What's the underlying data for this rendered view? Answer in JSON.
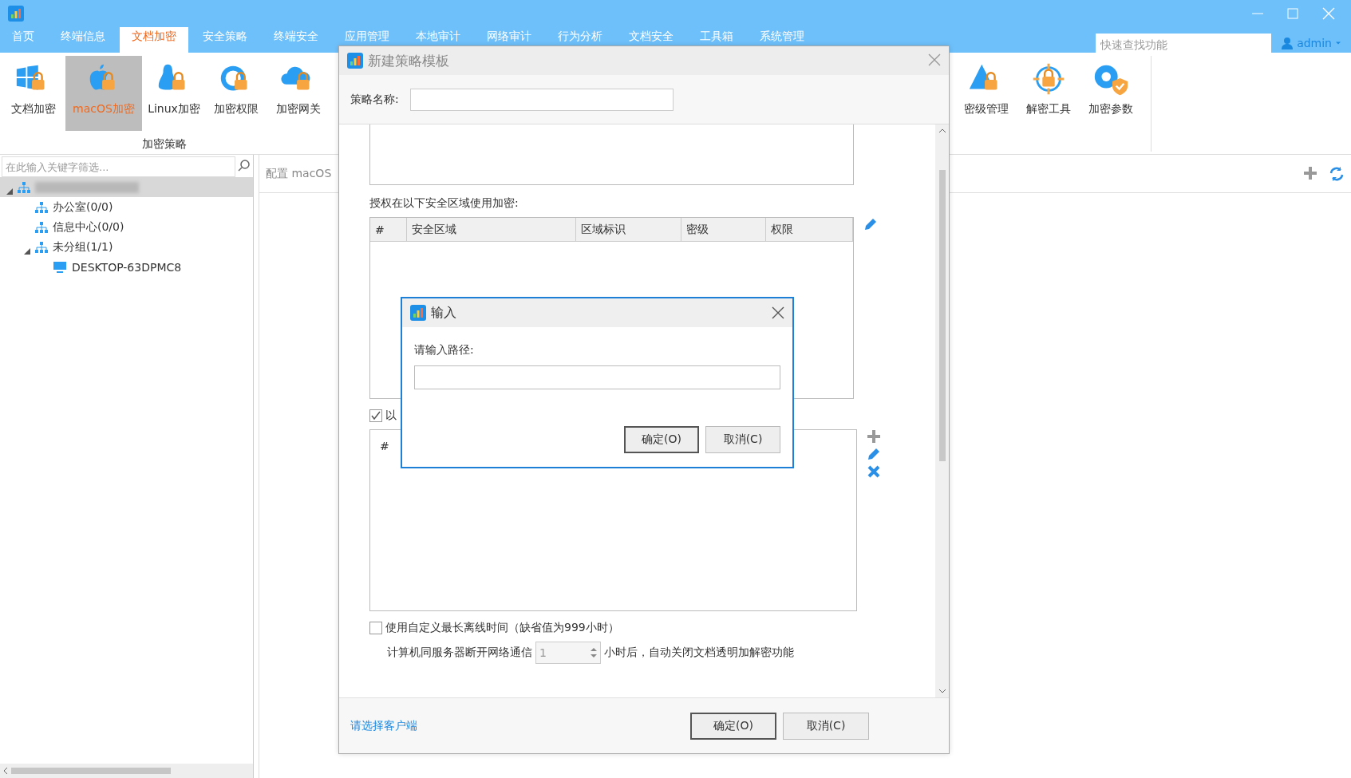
{
  "menu": [
    {
      "label": "首页",
      "selected": false
    },
    {
      "label": "终端信息",
      "selected": false
    },
    {
      "label": "文档加密",
      "selected": true
    },
    {
      "label": "安全策略",
      "selected": false
    },
    {
      "label": "终端安全",
      "selected": false
    },
    {
      "label": "应用管理",
      "selected": false
    },
    {
      "label": "本地审计",
      "selected": false
    },
    {
      "label": "网络审计",
      "selected": false
    },
    {
      "label": "行为分析",
      "selected": false
    },
    {
      "label": "文档安全",
      "selected": false
    },
    {
      "label": "工具箱",
      "selected": false
    },
    {
      "label": "系统管理",
      "selected": false
    }
  ],
  "quick_search": {
    "placeholder": "快速查找功能"
  },
  "user": "admin",
  "ribbon": {
    "left": [
      {
        "label": "文档加密",
        "selected": false
      },
      {
        "label": "macOS加密",
        "selected": true
      },
      {
        "label": "Linux加密",
        "selected": false
      },
      {
        "label": "加密权限",
        "selected": false
      },
      {
        "label": "加密网关",
        "selected": false
      }
    ],
    "group_label": "加密策略",
    "right": [
      {
        "label": "密级管理",
        "selected": false
      },
      {
        "label": "解密工具",
        "selected": false
      },
      {
        "label": "加密参数",
        "selected": false
      }
    ]
  },
  "filter": {
    "placeholder": "在此输入关键字筛选..."
  },
  "tree": [
    {
      "redacted": true,
      "expanded": true,
      "selected": true,
      "kind": "group",
      "children": [
        {
          "label": "办公室(0/0)",
          "kind": "group",
          "selected": false
        },
        {
          "label": "信息中心(0/0)",
          "kind": "group",
          "selected": false
        },
        {
          "label": "未分组(1/1)",
          "kind": "group",
          "expanded": true,
          "selected": false,
          "children": [
            {
              "label": "DESKTOP-63DPMC8",
              "kind": "computer",
              "selected": false
            }
          ]
        }
      ]
    }
  ],
  "main_tab": "配置 macOS",
  "dialog": {
    "title": "新建策略模板",
    "name_label": "策略名称:",
    "zones_label": "授权在以下安全区域使用加密:",
    "zones_columns": [
      "#",
      "安全区域",
      "区域标识",
      "密级",
      "权限"
    ],
    "option_checkbox": {
      "label": "以",
      "checked": true
    },
    "list_columns": [
      "#"
    ],
    "offline_checkbox": {
      "label": "使用自定义最长离线时间（缺省值为999小时）",
      "checked": false
    },
    "offline_prefix": "计算机同服务器断开网络通信",
    "offline_value": "1",
    "offline_suffix": "小时后，自动关闭文档透明加解密功能",
    "client_link": "请选择客户端",
    "ok": "确定(O)",
    "cancel": "取消(C)"
  },
  "input_dialog": {
    "title": "输入",
    "label": "请输入路径:",
    "ok": "确定(O)",
    "cancel": "取消(C)"
  }
}
